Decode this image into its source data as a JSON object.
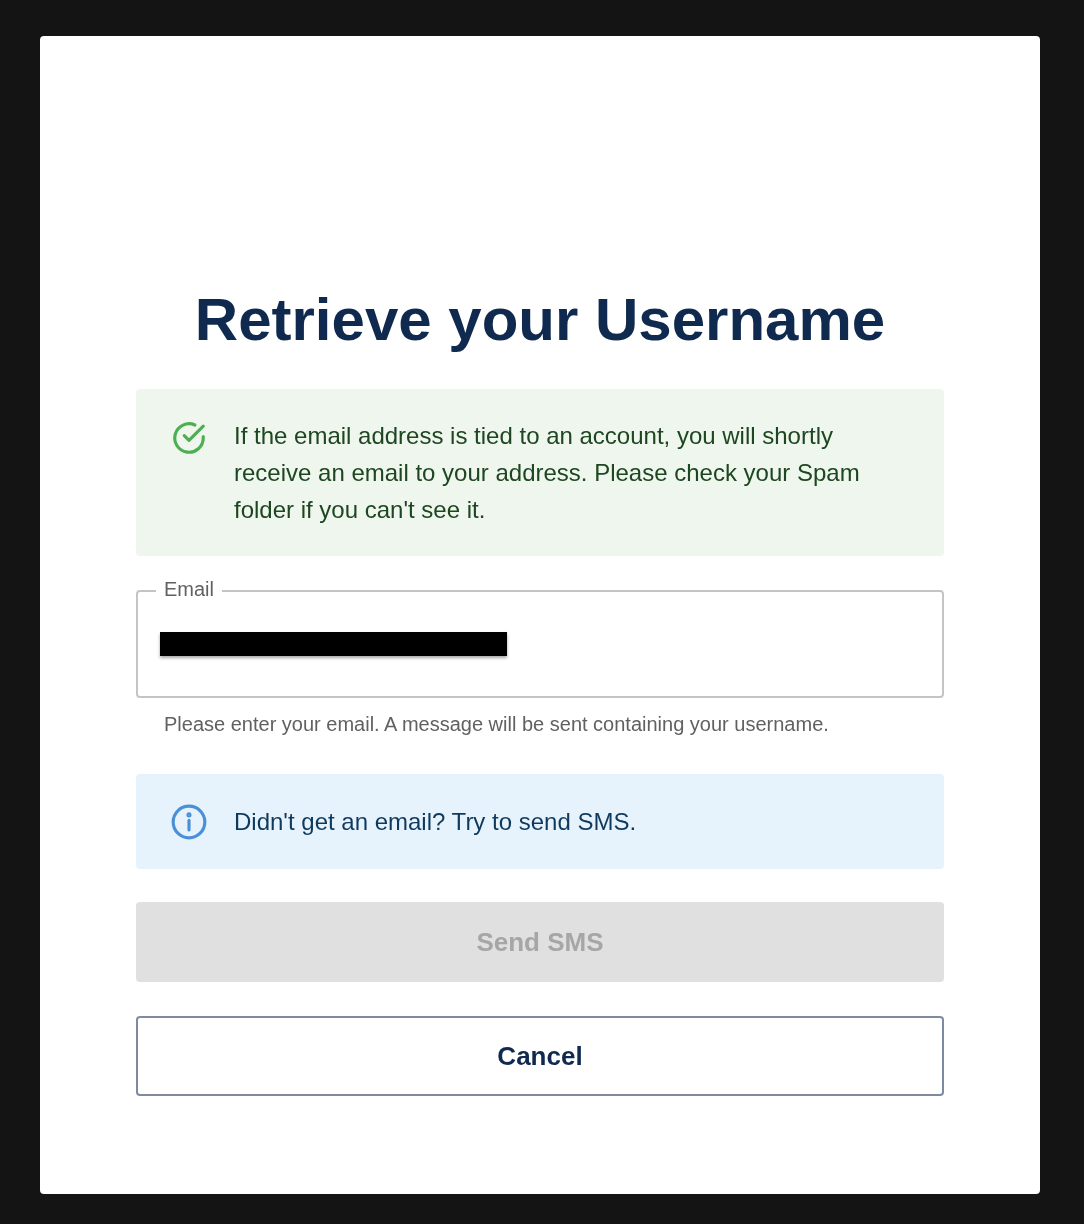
{
  "dialog": {
    "title": "Retrieve your Username"
  },
  "alerts": [
    {
      "kind": "success",
      "text": "If the email address is tied to an account, you will shortly receive an email to your address. Please check your Spam folder if you can't see it."
    }
  ],
  "email_field": {
    "label": "Email",
    "value_redacted": true,
    "helper": "Please enter your email. A message will be sent containing your username."
  },
  "sms_alert": {
    "kind": "info",
    "text": "Didn't get an email? Try to send SMS."
  },
  "buttons": [
    {
      "kind": "primary",
      "label": "Send SMS",
      "disabled": true
    },
    {
      "kind": "outline",
      "label": "Cancel",
      "disabled": false
    }
  ]
}
